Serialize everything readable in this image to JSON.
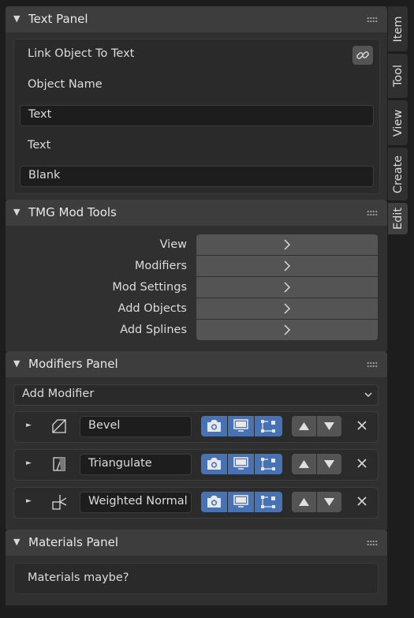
{
  "text_panel": {
    "title": "Text Panel",
    "link_label": "Link Object To Text",
    "object_name_label": "Object Name",
    "object_name_value": "Text",
    "text_label": "Text",
    "text_value": "Blank"
  },
  "tmg_panel": {
    "title": "TMG Mod Tools",
    "rows": [
      {
        "label": "View"
      },
      {
        "label": "Modifiers"
      },
      {
        "label": "Mod Settings"
      },
      {
        "label": "Add Objects"
      },
      {
        "label": "Add Splines"
      }
    ]
  },
  "modifiers_panel": {
    "title": "Modifiers Panel",
    "add_modifier": "Add Modifier",
    "modifiers": [
      {
        "name": "Bevel",
        "icon": "bevel-icon"
      },
      {
        "name": "Triangulate",
        "icon": "triangulate-icon"
      },
      {
        "name": "Weighted Normal",
        "icon": "weighted-normal-icon"
      }
    ]
  },
  "materials_panel": {
    "title": "Materials Panel",
    "text": "Materials maybe?"
  },
  "sidebar_tabs": [
    {
      "label": "Item",
      "active": false
    },
    {
      "label": "Tool",
      "active": false
    },
    {
      "label": "View",
      "active": false
    },
    {
      "label": "Create",
      "active": false
    },
    {
      "label": "Edit",
      "active": true
    }
  ],
  "colors": {
    "accent_blue": "#4772b3",
    "panel_header": "#3d3d3d",
    "panel_body": "#303030",
    "button": "#545454"
  }
}
